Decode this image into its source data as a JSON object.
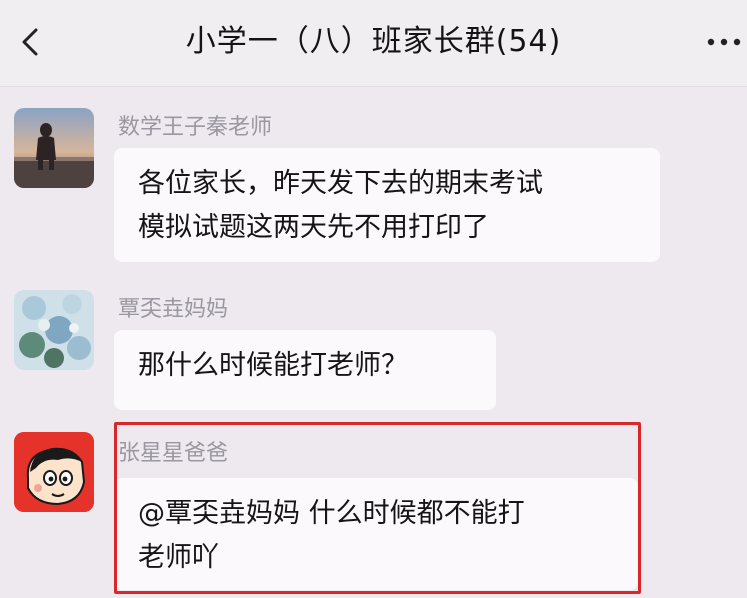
{
  "header": {
    "title": "小学一（八）班家长群(54)",
    "back_icon": "chevron-left-icon",
    "more_icon": "ellipsis-icon"
  },
  "messages": [
    {
      "sender": "数学王子秦老师",
      "avatar": "landscape-photo-avatar",
      "text_lines": [
        "各位家长，昨天发下去的期末考试",
        "模拟试题这两天先不用打印了"
      ]
    },
    {
      "sender": "覃奀垚妈妈",
      "avatar": "flowers-photo-avatar",
      "text_lines": [
        "那什么时候能打老师？"
      ]
    },
    {
      "sender": "张星星爸爸",
      "avatar": "cartoon-boy-avatar",
      "text_lines": [
        "@覃奀垚妈妈 什么时候都不能打",
        "老师吖"
      ]
    }
  ],
  "colors": {
    "background": "#ede9ee",
    "bubble": "#fbf9fc",
    "highlight": "#d8282a",
    "sender_name": "#9a97a0"
  }
}
